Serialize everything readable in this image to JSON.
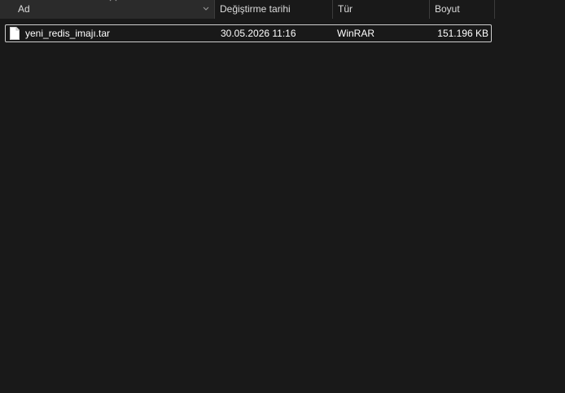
{
  "columns": {
    "name": "Ad",
    "date_modified": "Değiştirme tarihi",
    "type": "Tür",
    "size": "Boyut"
  },
  "icons": {
    "sort": "sort-up-icon",
    "column_menu": "chevron-down-icon",
    "file": "file-icon"
  },
  "files": [
    {
      "name": "yeni_redis_imajı.tar",
      "date_modified": "30.05.2026 11:16",
      "type": "WinRAR",
      "size": "151.196 KB"
    }
  ],
  "colors": {
    "background": "#191919",
    "header_active": "#2b2b2b",
    "selection_border": "#cfcfcf"
  }
}
